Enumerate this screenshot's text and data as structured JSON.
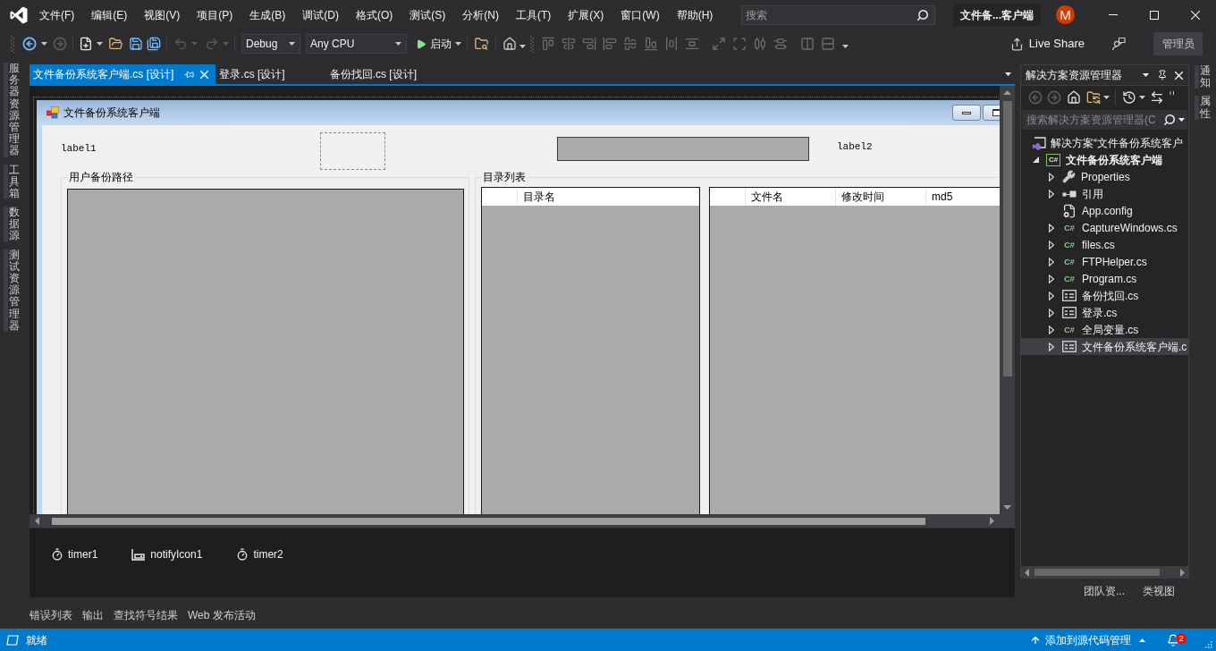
{
  "menu_bar": {
    "items": [
      "文件(F)",
      "编辑(E)",
      "视图(V)",
      "项目(P)",
      "生成(B)",
      "调试(D)",
      "格式(O)",
      "测试(S)",
      "分析(N)",
      "工具(T)",
      "扩展(X)",
      "窗口(W)",
      "帮助(H)"
    ],
    "search": {
      "placeholder": "搜索"
    },
    "solution_title": "文件备...客户端",
    "avatar": "M"
  },
  "toolbar": {
    "configuration": "Debug",
    "platform": "Any CPU",
    "start": "启动",
    "live_share": "Live Share",
    "admin": "管理员"
  },
  "left_tool_tabs": [
    "服务器资源管理器",
    "工具箱",
    "数据源",
    "测试资源管理器"
  ],
  "document_tabs": [
    {
      "label": "文件备份系统客户端.cs [设计]",
      "selected": true
    },
    {
      "label": "登录.cs [设计]",
      "selected": false
    },
    {
      "label": "备份找回.cs [设计]",
      "selected": false
    }
  ],
  "form": {
    "title": "文件备份系统客户端",
    "label_1": "label1",
    "label_2": "label2",
    "groups": [
      {
        "title": "用户备份路径",
        "kind": "path_box"
      },
      {
        "title": "目录列表",
        "kind": "lists",
        "lists": [
          {
            "columns": [
              "目录名"
            ]
          },
          {
            "columns": [
              "文件名",
              "修改时间",
              "md5"
            ]
          }
        ]
      }
    ]
  },
  "component_tray": [
    {
      "name": "timer1",
      "kind": "timer"
    },
    {
      "name": "notifyIcon1",
      "kind": "notify_icon"
    },
    {
      "name": "timer2",
      "kind": "timer"
    }
  ],
  "output_tabs": [
    "错误列表",
    "输出",
    "查找符号结果",
    "Web 发布活动"
  ],
  "solution_explorer": {
    "title": "解决方案资源管理器",
    "search": {
      "placeholder": "搜索解决方案资源管理器(C"
    },
    "tree": [
      {
        "label": "解决方案“文件备份系统客户",
        "kind": "solution",
        "selected": false,
        "children": [
          {
            "label": "文件备份系统客户端",
            "kind": "project",
            "icon_text": "C#",
            "expanded": true,
            "selected": false,
            "children": [
              {
                "label": "Properties",
                "kind": "properties",
                "expanded": false,
                "selected": false
              },
              {
                "label": "引用",
                "kind": "references",
                "expanded": false,
                "selected": false
              },
              {
                "label": "App.config",
                "kind": "config",
                "selected": false
              },
              {
                "label": "CaptureWindows.cs",
                "kind": "code",
                "icon_text": "C#",
                "expanded": false,
                "selected": false
              },
              {
                "label": "files.cs",
                "kind": "code",
                "icon_text": "C#",
                "expanded": false,
                "selected": false
              },
              {
                "label": "FTPHelper.cs",
                "kind": "code",
                "icon_text": "C#",
                "expanded": false,
                "selected": false
              },
              {
                "label": "Program.cs",
                "kind": "code",
                "icon_text": "C#",
                "expanded": false,
                "selected": false
              },
              {
                "label": "备份找回.cs",
                "kind": "form",
                "expanded": false,
                "selected": false
              },
              {
                "label": "登录.cs",
                "kind": "form",
                "expanded": false,
                "selected": false
              },
              {
                "label": "全局变量.cs",
                "kind": "code",
                "icon_text": "C#",
                "expanded": false,
                "selected": false
              },
              {
                "label": "文件备份系统客户端.c",
                "kind": "form",
                "expanded": false,
                "selected": true
              }
            ]
          }
        ]
      }
    ],
    "bottom_tabs": [
      "团队资...",
      "类视图"
    ]
  },
  "right_tool_tabs": [
    "通知",
    "属性"
  ],
  "status_bar": {
    "text": "就绪",
    "source_control": "添加到源代码管理",
    "notifications": "2"
  }
}
